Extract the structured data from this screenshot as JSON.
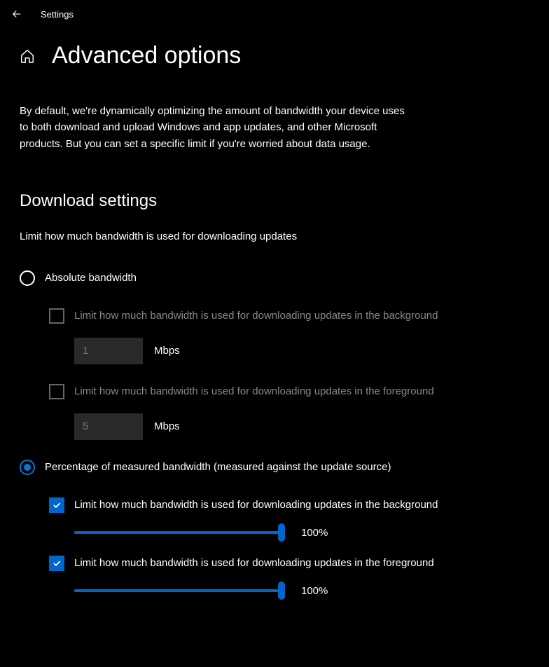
{
  "titlebar": {
    "app_name": "Settings"
  },
  "page": {
    "title": "Advanced options",
    "description": "By default, we're dynamically optimizing the amount of bandwidth your device uses to both download and upload Windows and app updates, and other Microsoft products. But you can set a specific limit if you're worried about data usage."
  },
  "download": {
    "section_title": "Download settings",
    "section_sub": "Limit how much bandwidth is used for downloading updates",
    "radio_absolute": "Absolute bandwidth",
    "radio_percentage": "Percentage of measured bandwidth (measured against the update source)",
    "selected_mode": "percentage",
    "absolute": {
      "bg_label": "Limit how much bandwidth is used for downloading updates in the background",
      "bg_value": "1",
      "fg_label": "Limit how much bandwidth is used for downloading updates in the foreground",
      "fg_value": "5",
      "unit": "Mbps"
    },
    "percentage": {
      "bg_label": "Limit how much bandwidth is used for downloading updates in the background",
      "bg_checked": true,
      "bg_percent": 100,
      "bg_percent_label": "100%",
      "fg_label": "Limit how much bandwidth is used for downloading updates in the foreground",
      "fg_checked": true,
      "fg_percent": 100,
      "fg_percent_label": "100%"
    }
  }
}
